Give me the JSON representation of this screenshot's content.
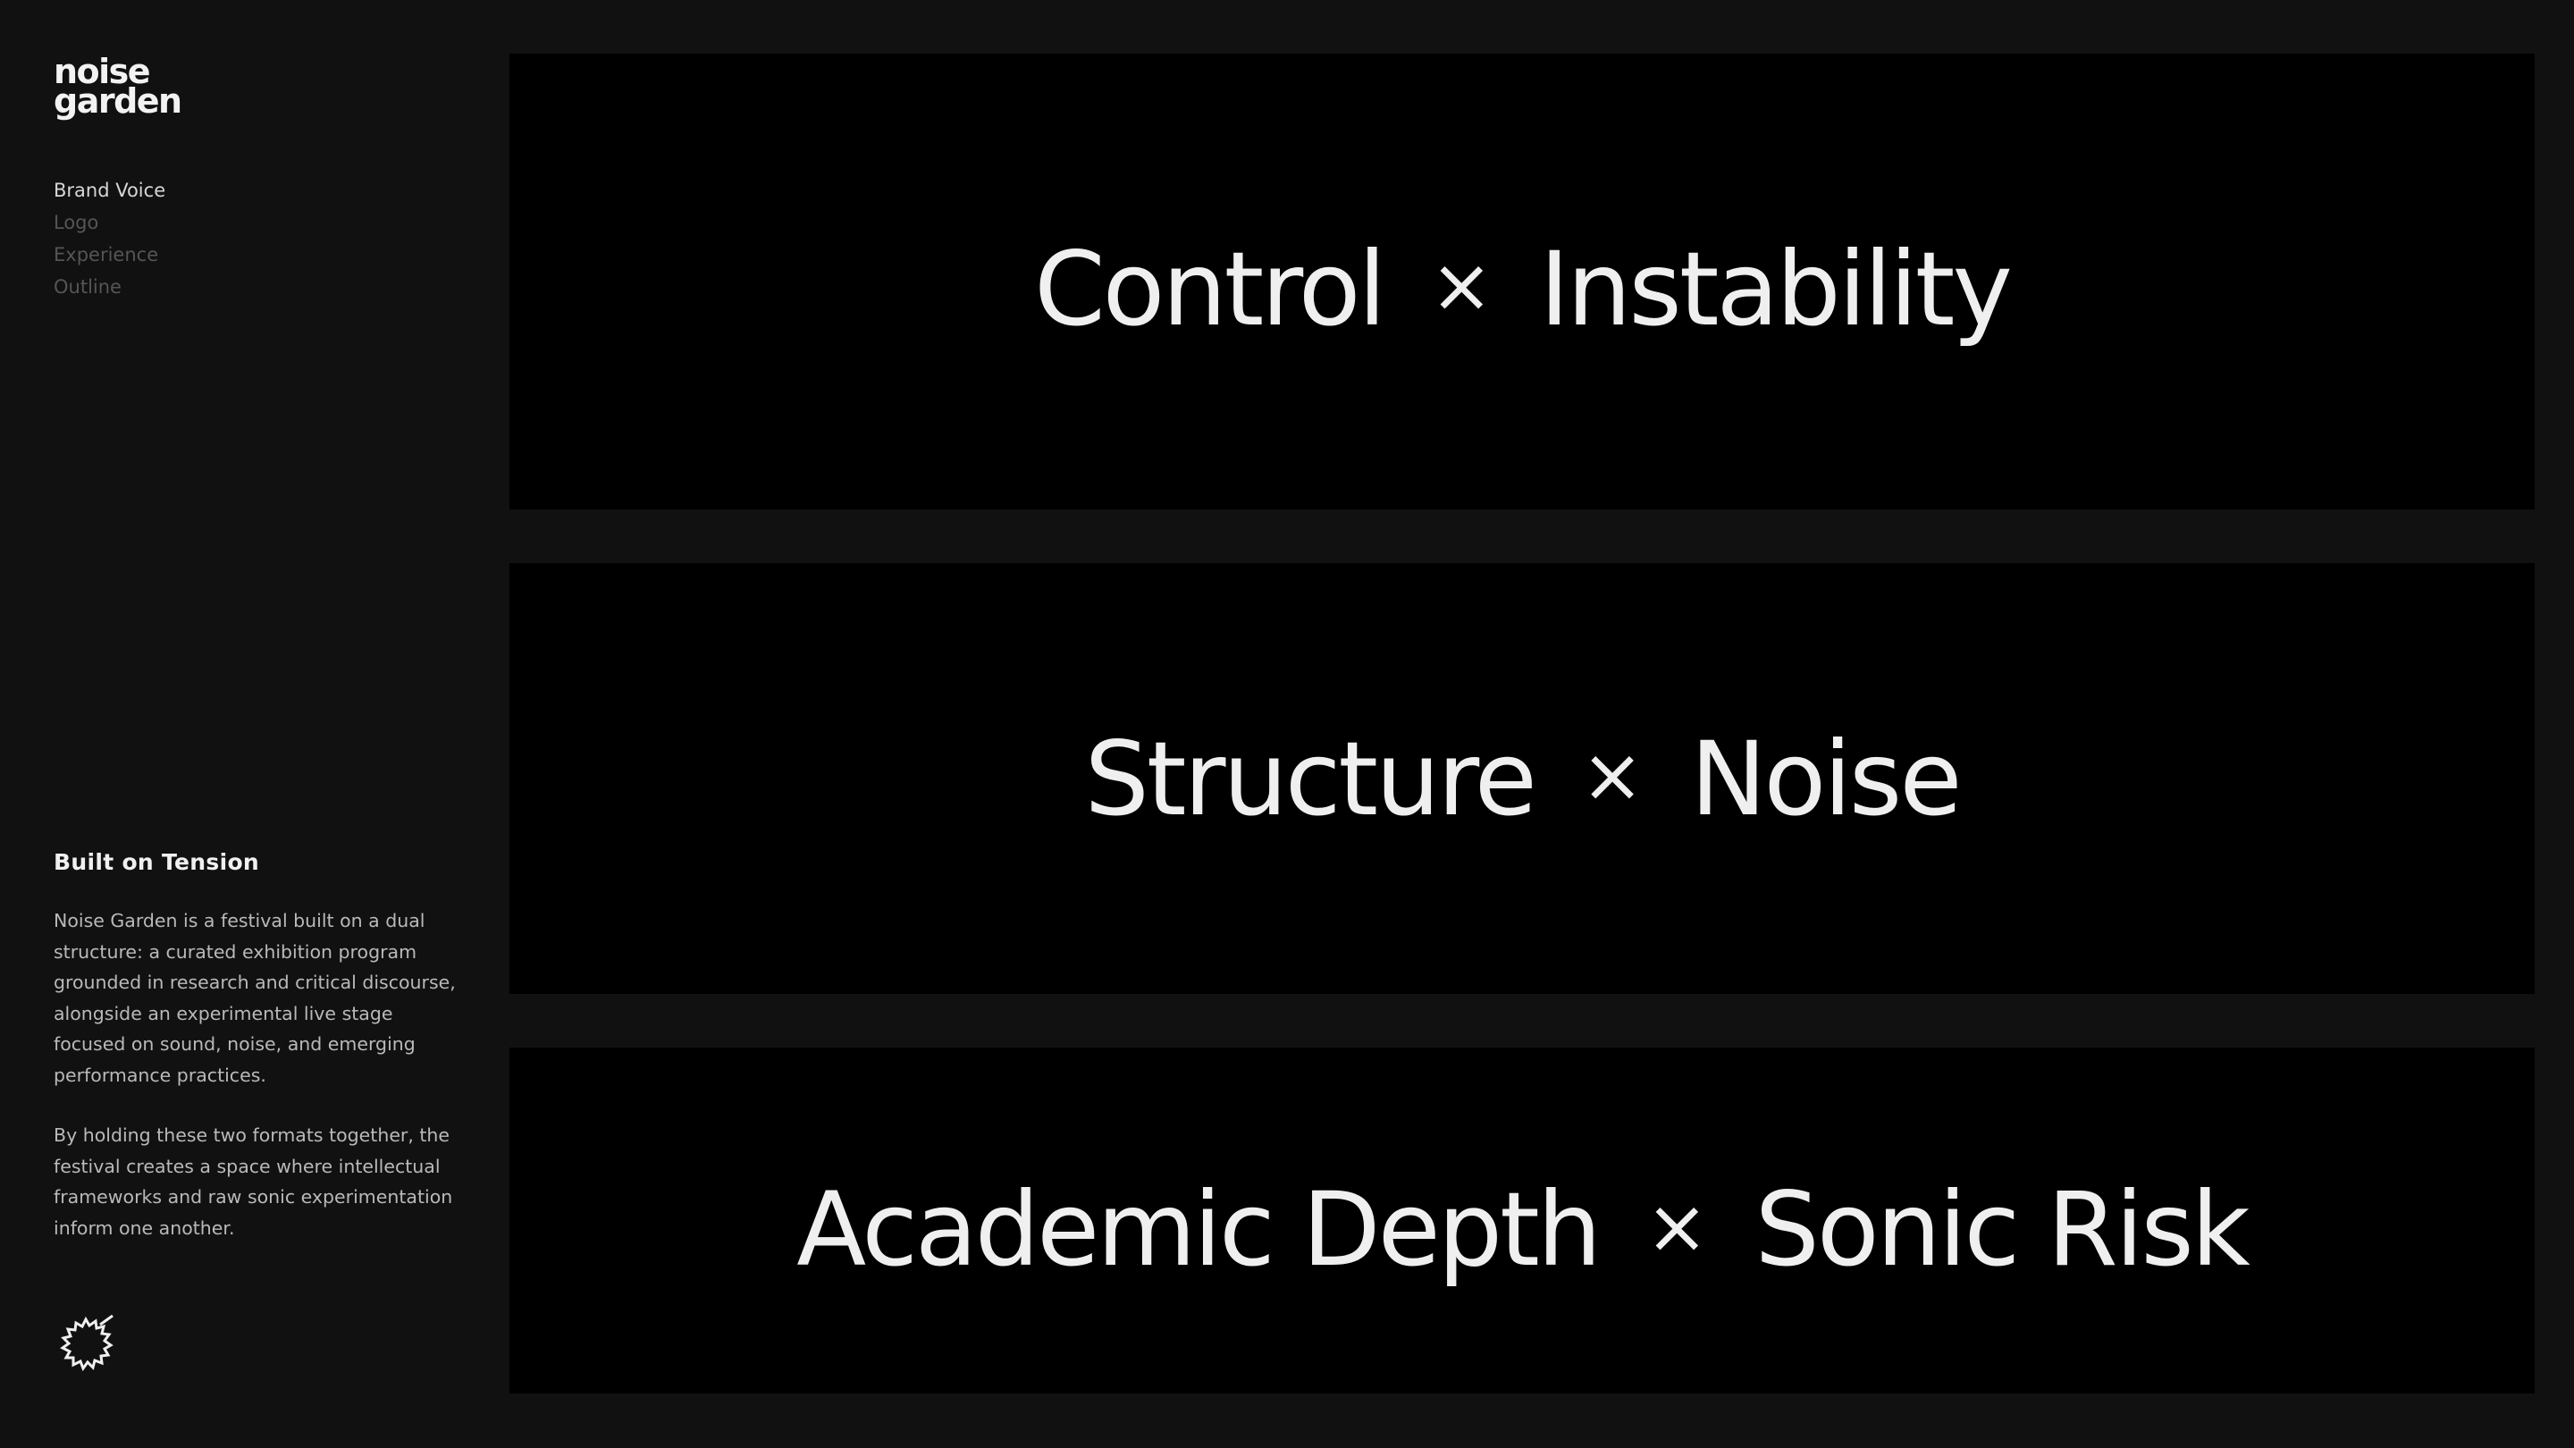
{
  "brand": {
    "logo_line1": "noise",
    "logo_line2": "garden"
  },
  "nav": {
    "items": [
      {
        "label": "Brand Voice",
        "active": true
      },
      {
        "label": "Logo",
        "active": false
      },
      {
        "label": "Experience",
        "active": false
      },
      {
        "label": "Outline",
        "active": false
      }
    ]
  },
  "info": {
    "heading": "Built on Tension",
    "paragraph1": "Noise Garden is a festival built on a dual structure: a curated exhibition program grounded in research and critical discourse, alongside an experimental live stage focused on sound, noise, and emerging performance practices.",
    "paragraph2": "By holding these two formats together, the festival creates a space where intellectual frameworks and raw sonic experimentation inform one another."
  },
  "emblem": {
    "icon": "spiky-circle-icon"
  },
  "tensions": [
    {
      "left": "Control",
      "separator": "×",
      "right": "Instability"
    },
    {
      "left": "Structure",
      "separator": "×",
      "right": "Noise"
    },
    {
      "left": "Academic Depth",
      "separator": "×",
      "right": "Sonic Risk"
    }
  ],
  "colors": {
    "page_background": "#111111",
    "panel_background": "#000000",
    "text_primary": "#efefef",
    "nav_inactive": "#555555",
    "body_text": "#b9b9b9"
  }
}
